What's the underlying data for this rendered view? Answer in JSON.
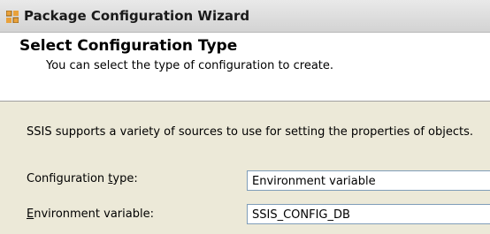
{
  "window": {
    "title": "Package Configuration Wizard",
    "icon": "wizard-app-icon"
  },
  "header": {
    "title": "Select Configuration Type",
    "subtitle": "You can select the type of configuration to create."
  },
  "main": {
    "description": "SSIS supports a variety of sources to use for setting the properties of objects.",
    "configuration_type": {
      "label_before": "Configuration ",
      "label_access_key": "t",
      "label_after": "ype:",
      "value": "Environment variable"
    },
    "environment_variable": {
      "label_access_key": "E",
      "label_after": "nvironment variable:",
      "value": "SSIS_CONFIG_DB"
    }
  },
  "colors": {
    "dialog_background": "#ece9d8",
    "header_background": "#ffffff",
    "field_border": "#7f9db9"
  }
}
